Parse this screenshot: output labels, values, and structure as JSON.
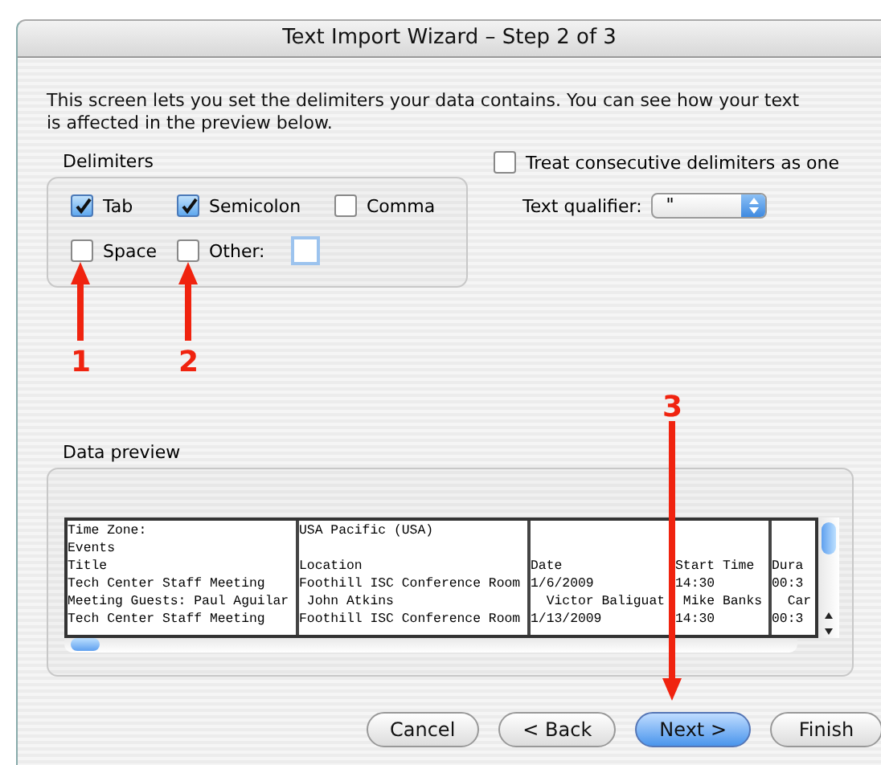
{
  "window": {
    "title": "Text Import Wizard – Step 2 of 3"
  },
  "intro": "This screen lets you set the delimiters your data contains.  You can see how your text is affected in the preview below.",
  "delimiters": {
    "label": "Delimiters",
    "options": [
      {
        "label": "Tab",
        "checked": true
      },
      {
        "label": "Semicolon",
        "checked": true
      },
      {
        "label": "Comma",
        "checked": false
      },
      {
        "label": "Space",
        "checked": false
      },
      {
        "label": "Other:",
        "checked": false,
        "kind": "other"
      }
    ]
  },
  "treat_consecutive": {
    "label": "Treat consecutive delimiters as one",
    "checked": false
  },
  "text_qualifier": {
    "label": "Text qualifier:",
    "value": "\""
  },
  "data_preview": {
    "label": "Data preview",
    "rows": [
      {
        "column_1": "Time Zone:",
        "column_2": "USA Pacific (USA)"
      },
      {
        "column_1": "Events"
      },
      {
        "column_1": "Title",
        "column_2": "Location",
        "column_3": "Date",
        "column_4": "Start Time",
        "column_5": "Dura"
      },
      {
        "column_1": "Tech Center Staff Meeting",
        "column_2": "Foothill ISC Conference Room",
        "column_3": "1/6/2009",
        "column_4": "14:30",
        "column_5": "00:3"
      },
      {
        "column_1": "Meeting Guests: Paul Aguilar",
        "column_2": " John Atkins",
        "column_3": "  Victor Baliguat",
        "column_4": " Mike Banks",
        "column_5": "  Car"
      },
      {
        "column_1": "Tech Center Staff Meeting",
        "column_2": "Foothill ISC Conference Room",
        "column_3": "1/13/2009",
        "column_4": "14:30",
        "column_5": "00:3"
      }
    ]
  },
  "buttons": [
    {
      "label": "Cancel",
      "default": false
    },
    {
      "label": "< Back",
      "default": false
    },
    {
      "label": "Next >",
      "default": true
    },
    {
      "label": "Finish",
      "default": false
    }
  ],
  "annotations": [
    {
      "label": "1"
    },
    {
      "label": "2"
    },
    {
      "label": "3"
    }
  ]
}
